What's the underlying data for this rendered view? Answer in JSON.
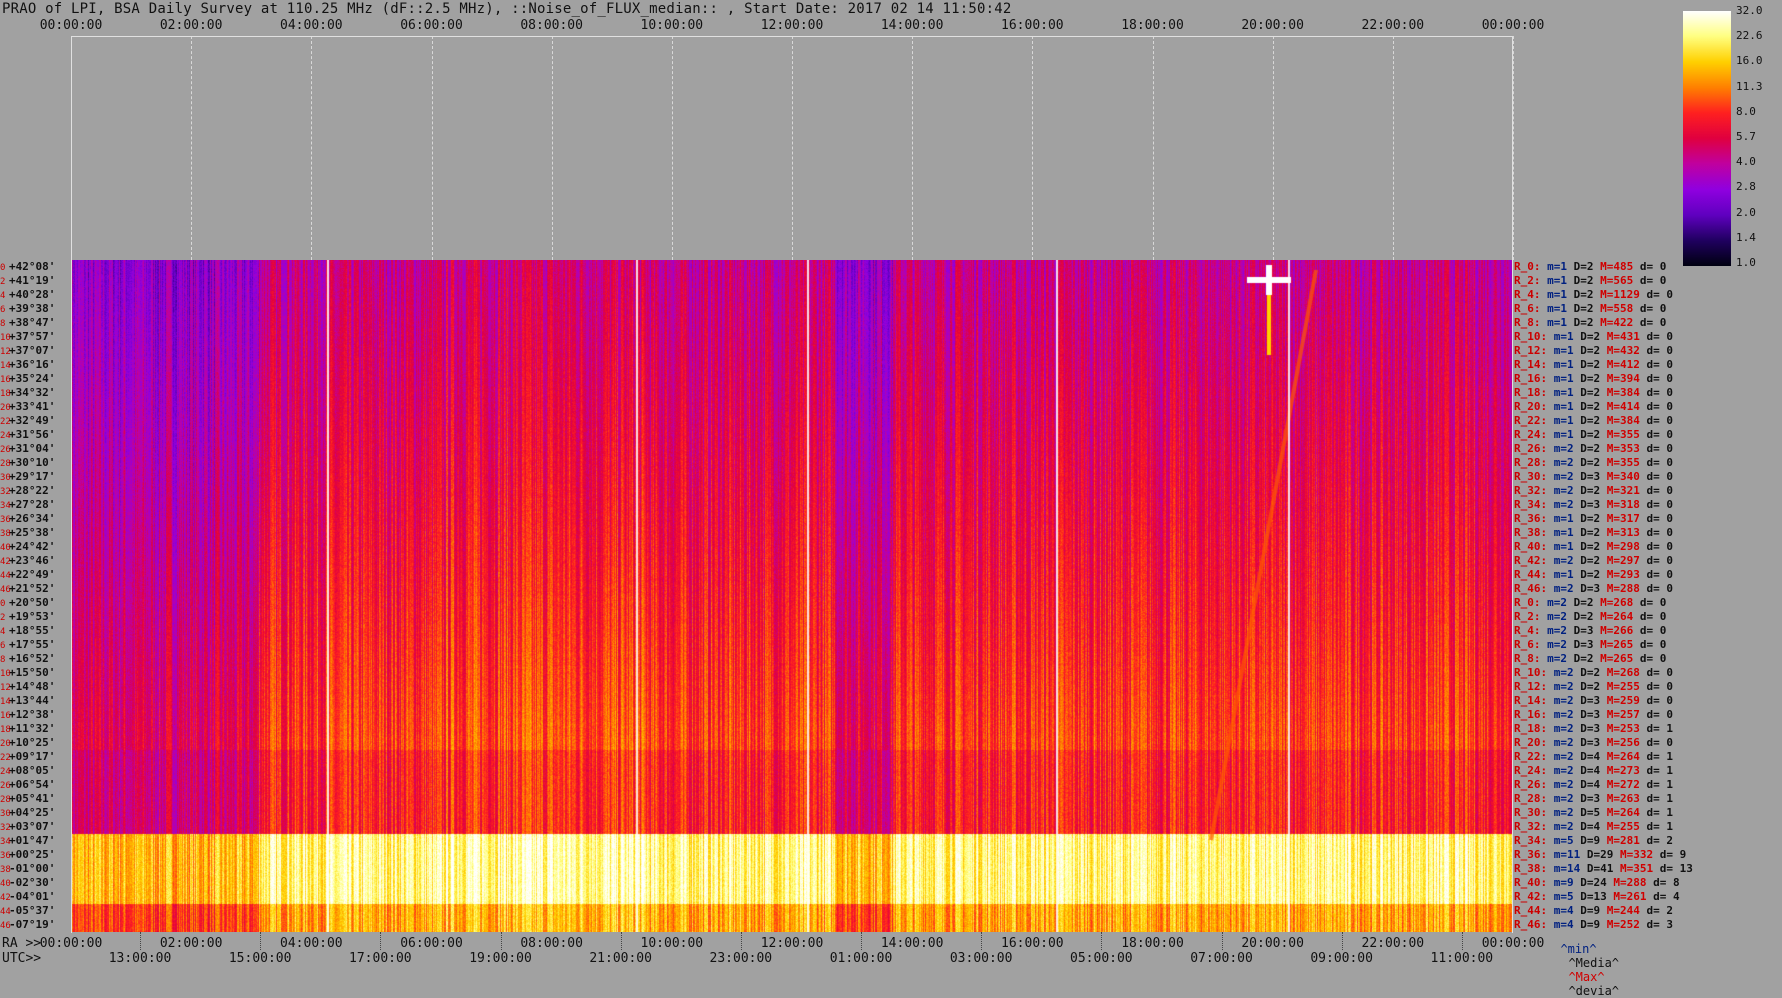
{
  "title": "PRAO of LPI, BSA Daily Survey at 110.25 MHz (dF::2.5 MHz), ::Noise_of_FLUX_median:: , Start Date: 2017 02 14 11:50:42",
  "chart_data": {
    "type": "heatmap",
    "title": "PRAO of LPI, BSA Daily Survey at 110.25 MHz (dF::2.5 MHz), ::Noise_of_FLUX_median:: , Start Date: 2017 02 14 11:50:42",
    "top_time_ticks": [
      "00:00:00",
      "02:00:00",
      "04:00:00",
      "06:00:00",
      "08:00:00",
      "10:00:00",
      "12:00:00",
      "14:00:00",
      "16:00:00",
      "18:00:00",
      "20:00:00",
      "22:00:00",
      "00:00:00"
    ],
    "ra_prefix": "RA >>",
    "ra_ticks": [
      "00:00:00",
      "02:00:00",
      "04:00:00",
      "06:00:00",
      "08:00:00",
      "10:00:00",
      "12:00:00",
      "14:00:00",
      "16:00:00",
      "18:00:00",
      "20:00:00",
      "22:00:00",
      "00:00:00"
    ],
    "utc_prefix": "UTC>>",
    "utc_ticks": [
      "13:00:00",
      "15:00:00",
      "17:00:00",
      "19:00:00",
      "21:00:00",
      "23:00:00",
      "01:00:00",
      "03:00:00",
      "05:00:00",
      "07:00:00",
      "09:00:00",
      "11:00:00"
    ],
    "declinations": [
      "+42°08'",
      "+41°19'",
      "+40°28'",
      "+39°38'",
      "+38°47'",
      "+37°57'",
      "+37°07'",
      "+36°16'",
      "+35°24'",
      "+34°32'",
      "+33°41'",
      "+32°49'",
      "+31°56'",
      "+31°04'",
      "+30°10'",
      "+29°17'",
      "+28°22'",
      "+27°28'",
      "+26°34'",
      "+25°38'",
      "+24°42'",
      "+23°46'",
      "+22°49'",
      "+21°52'",
      "+20°50'",
      "+19°53'",
      "+18°55'",
      "+17°55'",
      "+16°52'",
      "+15°50'",
      "+14°48'",
      "+13°44'",
      "+12°38'",
      "+11°32'",
      "+10°25'",
      "+09°17'",
      "+08°05'",
      "+06°54'",
      "+05°41'",
      "+04°25'",
      "+03°07'",
      "+01°47'",
      "+00°25'",
      "-01°00'",
      "-02°30'",
      "-04°01'",
      "-05°37'",
      "-07°19'"
    ],
    "row_indices": [
      "0",
      "2",
      "4",
      "6",
      "8",
      "10",
      "12",
      "14",
      "16",
      "18",
      "20",
      "22",
      "24",
      "26",
      "28",
      "30",
      "32",
      "34",
      "36",
      "38",
      "40",
      "42",
      "44",
      "46",
      "0",
      "2",
      "4",
      "6",
      "8",
      "10",
      "12",
      "14",
      "16",
      "18",
      "20",
      "22",
      "24",
      "26",
      "28",
      "30",
      "32",
      "34",
      "36",
      "38",
      "40",
      "42",
      "44",
      "46"
    ],
    "colorbar": {
      "ticks": [
        "32.0",
        "22.6",
        "16.0",
        "11.3",
        "8.0",
        "5.7",
        "4.0",
        "2.8",
        "2.0",
        "1.4",
        "1.0"
      ],
      "colors": [
        "#ffffff",
        "#ffff80",
        "#ffd000",
        "#ff8000",
        "#ff2020",
        "#e00040",
        "#c000a0",
        "#9000e0",
        "#6000c0",
        "#200060",
        "#000010"
      ]
    },
    "stats": [
      {
        "r": "R_0:",
        "m": "m=1",
        "D": "D=2",
        "M": "M=485",
        "d": "d= 0"
      },
      {
        "r": "R_2:",
        "m": "m=1",
        "D": "D=2",
        "M": "M=565",
        "d": "d= 0"
      },
      {
        "r": "R_4:",
        "m": "m=1",
        "D": "D=2",
        "M": "M=1129",
        "d": "d= 0"
      },
      {
        "r": "R_6:",
        "m": "m=1",
        "D": "D=2",
        "M": "M=558",
        "d": "d= 0"
      },
      {
        "r": "R_8:",
        "m": "m=1",
        "D": "D=2",
        "M": "M=422",
        "d": "d= 0"
      },
      {
        "r": "R_10:",
        "m": "m=1",
        "D": "D=2",
        "M": "M=431",
        "d": "d= 0"
      },
      {
        "r": "R_12:",
        "m": "m=1",
        "D": "D=2",
        "M": "M=432",
        "d": "d= 0"
      },
      {
        "r": "R_14:",
        "m": "m=1",
        "D": "D=2",
        "M": "M=412",
        "d": "d= 0"
      },
      {
        "r": "R_16:",
        "m": "m=1",
        "D": "D=2",
        "M": "M=394",
        "d": "d= 0"
      },
      {
        "r": "R_18:",
        "m": "m=1",
        "D": "D=2",
        "M": "M=384",
        "d": "d= 0"
      },
      {
        "r": "R_20:",
        "m": "m=1",
        "D": "D=2",
        "M": "M=414",
        "d": "d= 0"
      },
      {
        "r": "R_22:",
        "m": "m=1",
        "D": "D=2",
        "M": "M=384",
        "d": "d= 0"
      },
      {
        "r": "R_24:",
        "m": "m=1",
        "D": "D=2",
        "M": "M=355",
        "d": "d= 0"
      },
      {
        "r": "R_26:",
        "m": "m=2",
        "D": "D=2",
        "M": "M=353",
        "d": "d= 0"
      },
      {
        "r": "R_28:",
        "m": "m=2",
        "D": "D=2",
        "M": "M=355",
        "d": "d= 0"
      },
      {
        "r": "R_30:",
        "m": "m=2",
        "D": "D=3",
        "M": "M=340",
        "d": "d= 0"
      },
      {
        "r": "R_32:",
        "m": "m=2",
        "D": "D=2",
        "M": "M=321",
        "d": "d= 0"
      },
      {
        "r": "R_34:",
        "m": "m=2",
        "D": "D=3",
        "M": "M=318",
        "d": "d= 0"
      },
      {
        "r": "R_36:",
        "m": "m=1",
        "D": "D=2",
        "M": "M=317",
        "d": "d= 0"
      },
      {
        "r": "R_38:",
        "m": "m=1",
        "D": "D=2",
        "M": "M=313",
        "d": "d= 0"
      },
      {
        "r": "R_40:",
        "m": "m=1",
        "D": "D=2",
        "M": "M=298",
        "d": "d= 0"
      },
      {
        "r": "R_42:",
        "m": "m=2",
        "D": "D=2",
        "M": "M=297",
        "d": "d= 0"
      },
      {
        "r": "R_44:",
        "m": "m=1",
        "D": "D=2",
        "M": "M=293",
        "d": "d= 0"
      },
      {
        "r": "R_46:",
        "m": "m=2",
        "D": "D=3",
        "M": "M=288",
        "d": "d= 0"
      },
      {
        "r": "R_0:",
        "m": "m=2",
        "D": "D=2",
        "M": "M=268",
        "d": "d= 0"
      },
      {
        "r": "R_2:",
        "m": "m=2",
        "D": "D=2",
        "M": "M=264",
        "d": "d= 0"
      },
      {
        "r": "R_4:",
        "m": "m=2",
        "D": "D=3",
        "M": "M=266",
        "d": "d= 0"
      },
      {
        "r": "R_6:",
        "m": "m=2",
        "D": "D=3",
        "M": "M=265",
        "d": "d= 0"
      },
      {
        "r": "R_8:",
        "m": "m=2",
        "D": "D=2",
        "M": "M=265",
        "d": "d= 0"
      },
      {
        "r": "R_10:",
        "m": "m=2",
        "D": "D=2",
        "M": "M=268",
        "d": "d= 0"
      },
      {
        "r": "R_12:",
        "m": "m=2",
        "D": "D=2",
        "M": "M=255",
        "d": "d= 0"
      },
      {
        "r": "R_14:",
        "m": "m=2",
        "D": "D=3",
        "M": "M=259",
        "d": "d= 0"
      },
      {
        "r": "R_16:",
        "m": "m=2",
        "D": "D=3",
        "M": "M=257",
        "d": "d= 0"
      },
      {
        "r": "R_18:",
        "m": "m=2",
        "D": "D=3",
        "M": "M=253",
        "d": "d= 1"
      },
      {
        "r": "R_20:",
        "m": "m=2",
        "D": "D=3",
        "M": "M=256",
        "d": "d= 0"
      },
      {
        "r": "R_22:",
        "m": "m=2",
        "D": "D=4",
        "M": "M=264",
        "d": "d= 1"
      },
      {
        "r": "R_24:",
        "m": "m=2",
        "D": "D=4",
        "M": "M=273",
        "d": "d= 1"
      },
      {
        "r": "R_26:",
        "m": "m=2",
        "D": "D=4",
        "M": "M=272",
        "d": "d= 1"
      },
      {
        "r": "R_28:",
        "m": "m=2",
        "D": "D=3",
        "M": "M=263",
        "d": "d= 1"
      },
      {
        "r": "R_30:",
        "m": "m=2",
        "D": "D=5",
        "M": "M=264",
        "d": "d= 1"
      },
      {
        "r": "R_32:",
        "m": "m=2",
        "D": "D=4",
        "M": "M=255",
        "d": "d= 1"
      },
      {
        "r": "R_34:",
        "m": "m=5",
        "D": "D=9",
        "M": "M=281",
        "d": "d= 2"
      },
      {
        "r": "R_36:",
        "m": "m=11",
        "D": "D=29",
        "M": "M=332",
        "d": "d= 9"
      },
      {
        "r": "R_38:",
        "m": "m=14",
        "D": "D=41",
        "M": "M=351",
        "d": "d= 13"
      },
      {
        "r": "R_40:",
        "m": "m=9",
        "D": "D=24",
        "M": "M=288",
        "d": "d= 8"
      },
      {
        "r": "R_42:",
        "m": "m=5",
        "D": "D=13",
        "M": "M=261",
        "d": "d= 4"
      },
      {
        "r": "R_44:",
        "m": "m=4",
        "D": "D=9",
        "M": "M=244",
        "d": "d= 2"
      },
      {
        "r": "R_46:",
        "m": "m=4",
        "D": "D=9",
        "M": "M=252",
        "d": "d= 3"
      }
    ],
    "legend": {
      "min": "^min^",
      "median": "^Media^",
      "max": "^Max^",
      "devia": "^devia^"
    }
  }
}
